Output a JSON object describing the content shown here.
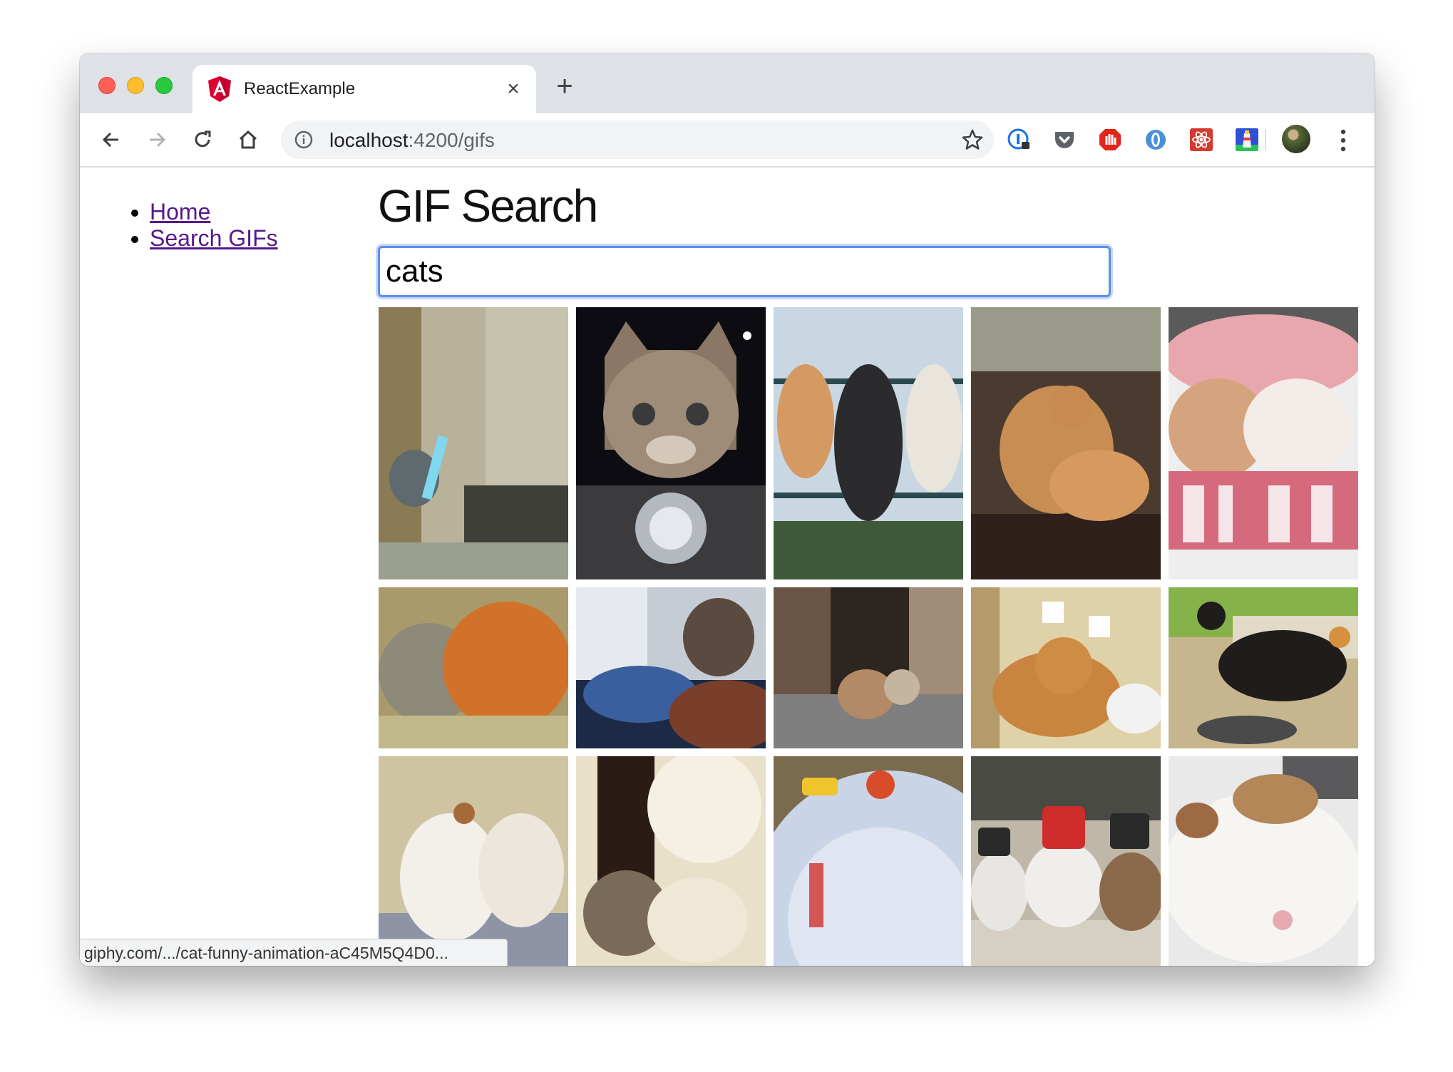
{
  "browser": {
    "tab_title": "ReactExample",
    "new_tab_label": "+",
    "close_tab_label": "×",
    "url_host": "localhost",
    "url_rest": ":4200/gifs",
    "status_url": "giphy.com/.../cat-funny-animation-aC45M5Q4D0..."
  },
  "nav": {
    "items": [
      {
        "label": "Home"
      },
      {
        "label": "Search GIFs"
      }
    ]
  },
  "page": {
    "title": "GIF Search",
    "search_value": "cats"
  },
  "extensions": [
    "1password-icon",
    "pocket-icon",
    "adblock-icon",
    "opera-vpn-icon",
    "react-devtools-icon",
    "lighthouse-icon"
  ],
  "gifs": [
    {
      "name": "gif-cat-lightsaber"
    },
    {
      "name": "gif-cat-motorcycle"
    },
    {
      "name": "gif-cats-on-fence"
    },
    {
      "name": "gif-cats-on-couch"
    },
    {
      "name": "gif-cats-stay-warm"
    },
    {
      "name": "gif-cats-cuddling"
    },
    {
      "name": "gif-cat-window"
    },
    {
      "name": "gif-cat-doorway"
    },
    {
      "name": "gif-cat-chef-hat"
    },
    {
      "name": "gif-cat-black-dancing"
    },
    {
      "name": "gif-cats-white-hugging"
    },
    {
      "name": "gif-cats-grooming"
    },
    {
      "name": "gif-plate"
    },
    {
      "name": "gif-cats-with-hats"
    },
    {
      "name": "gif-cats-sleeping"
    }
  ]
}
